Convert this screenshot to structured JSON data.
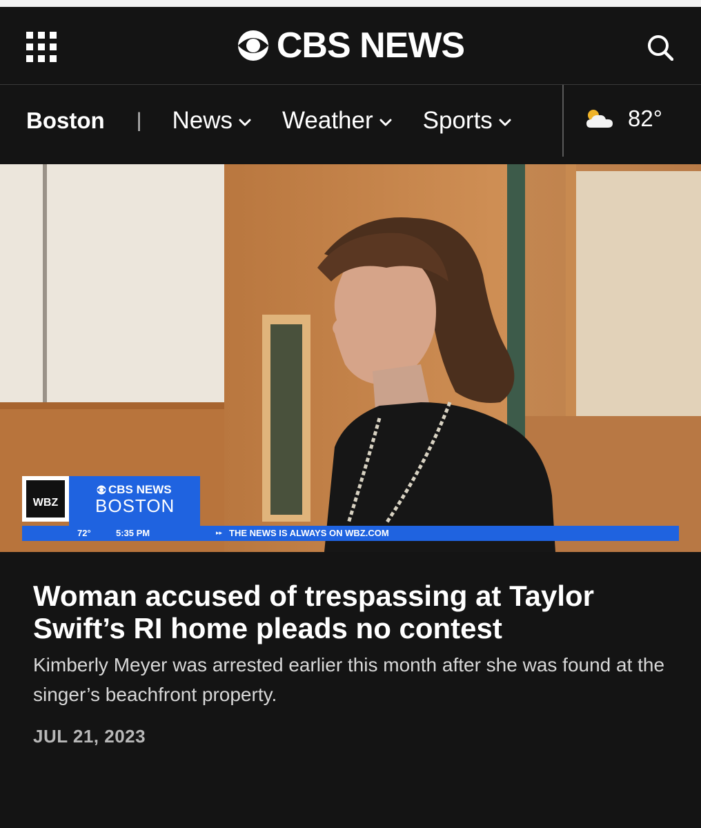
{
  "header": {
    "brand": "CBS NEWS",
    "menu_icon": "grid-menu-icon",
    "search_icon": "search-icon"
  },
  "nav": {
    "city": "Boston",
    "separator": "|",
    "items": [
      {
        "label": "News"
      },
      {
        "label": "Weather"
      },
      {
        "label": "Sports"
      }
    ],
    "weather": {
      "icon": "partly-cloudy-icon",
      "temp": "82°"
    }
  },
  "hero": {
    "overlay": {
      "station": "WBZ",
      "brand": "CBS NEWS",
      "city": "BOSTON",
      "temp": "72°",
      "time": "5:35 PM",
      "ticker": "THE NEWS IS ALWAYS ON WBZ.COM"
    }
  },
  "article": {
    "headline": "Woman accused of trespassing at Taylor Swift’s RI home pleads no contest",
    "dek": "Kimberly Meyer was arrested earlier this month after she was found at the singer’s beachfront property.",
    "date": "JUL 21, 2023"
  },
  "colors": {
    "background": "#141414",
    "chyron_blue": "#1f63e0"
  }
}
